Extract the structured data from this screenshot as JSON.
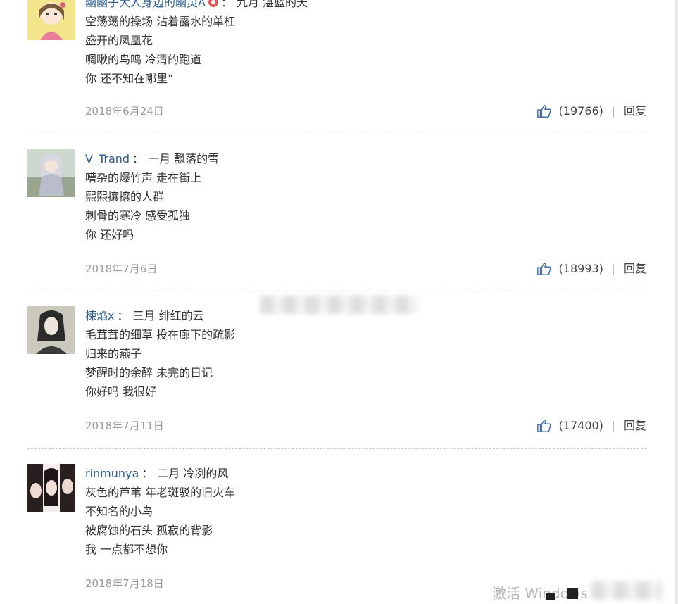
{
  "comments": [
    {
      "user": "幽幽子大人身边的幽灵A",
      "first_line": "九月 湛蓝的天",
      "lines": [
        "空荡荡的操场 沾着露水的单杠",
        "盛开的凤凰花",
        "啁啾的鸟鸣 冷清的跑道",
        "你 还不知在哪里”"
      ],
      "date": "2018年6月24日",
      "likes": "(19766)",
      "reply": "回复"
    },
    {
      "user": "V_Trand",
      "first_line": "一月 飘落的雪",
      "lines": [
        "嘈杂的爆竹声 走在街上",
        "熙熙攘攘的人群",
        "刺骨的寒冷 感受孤独",
        "你 还好吗"
      ],
      "date": "2018年7月6日",
      "likes": "(18993)",
      "reply": "回复"
    },
    {
      "user": "楝焰x",
      "first_line": "三月 绯红的云",
      "lines": [
        "毛茸茸的细草 投在廊下的疏影",
        "归来的燕子",
        "梦醒时的余醉 未完的日记",
        "你好吗 我很好"
      ],
      "date": "2018年7月11日",
      "likes": "(17400)",
      "reply": "回复"
    },
    {
      "user": "rinmunya",
      "first_line": "二月 冷冽的风",
      "lines": [
        "灰色的芦苇 年老斑驳的旧火车",
        "不知名的小鸟",
        "被腐蚀的石头 孤寂的背影",
        "我 一点都不想你"
      ],
      "date": "2018年7月18日"
    }
  ],
  "separator": "：",
  "bar": "|",
  "watermark": "激活 Windows",
  "colors": {
    "username": "#2a5c8f",
    "date": "#999999",
    "icon": "#3d6fa8"
  },
  "icons": {
    "like": "thumbs-up-icon",
    "verified": "vip-badge-icon"
  }
}
